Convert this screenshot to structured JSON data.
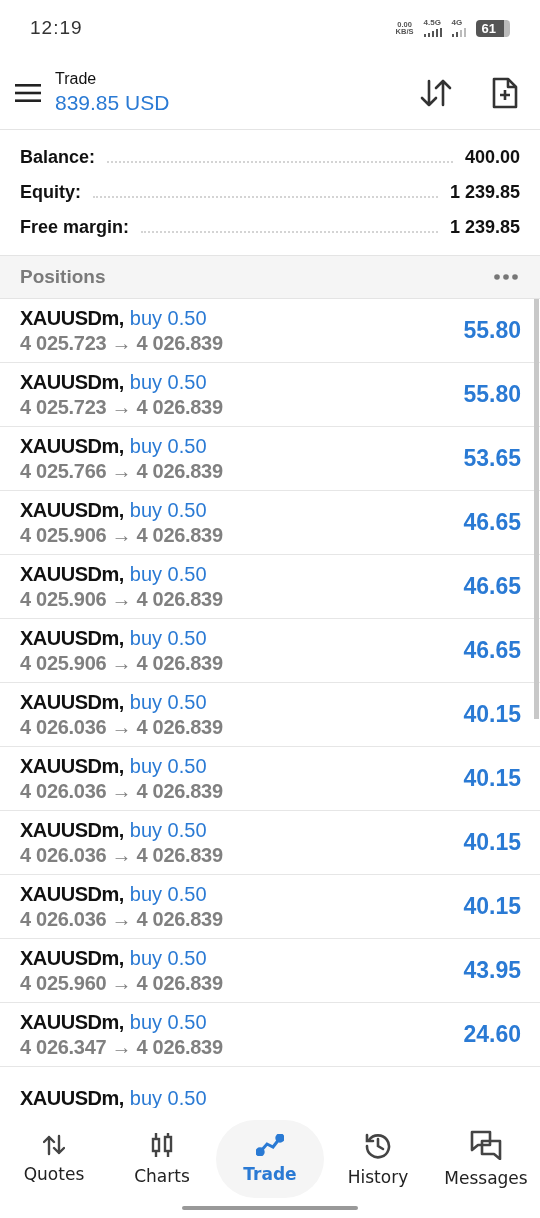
{
  "status_bar": {
    "time": "12:19",
    "speed_value": "0.00",
    "speed_unit": "KB/S",
    "network_1": "4.5G",
    "network_2": "4G",
    "battery": "61"
  },
  "header": {
    "title": "Trade",
    "balance": "839.85 USD"
  },
  "summary": [
    {
      "label": "Balance:",
      "value": "400.00"
    },
    {
      "label": "Equity:",
      "value": "1 239.85"
    },
    {
      "label": "Free margin:",
      "value": "1 239.85"
    }
  ],
  "positions": {
    "title": "Positions",
    "rows": [
      {
        "symbol": "XAUUSDm,",
        "side": "buy 0.50",
        "prices": "4 025.723 → 4 026.839",
        "profit": "55.80"
      },
      {
        "symbol": "XAUUSDm,",
        "side": "buy 0.50",
        "prices": "4 025.723 → 4 026.839",
        "profit": "55.80"
      },
      {
        "symbol": "XAUUSDm,",
        "side": "buy 0.50",
        "prices": "4 025.766 → 4 026.839",
        "profit": "53.65"
      },
      {
        "symbol": "XAUUSDm,",
        "side": "buy 0.50",
        "prices": "4 025.906 → 4 026.839",
        "profit": "46.65"
      },
      {
        "symbol": "XAUUSDm,",
        "side": "buy 0.50",
        "prices": "4 025.906 → 4 026.839",
        "profit": "46.65"
      },
      {
        "symbol": "XAUUSDm,",
        "side": "buy 0.50",
        "prices": "4 025.906 → 4 026.839",
        "profit": "46.65"
      },
      {
        "symbol": "XAUUSDm,",
        "side": "buy 0.50",
        "prices": "4 026.036 → 4 026.839",
        "profit": "40.15"
      },
      {
        "symbol": "XAUUSDm,",
        "side": "buy 0.50",
        "prices": "4 026.036 → 4 026.839",
        "profit": "40.15"
      },
      {
        "symbol": "XAUUSDm,",
        "side": "buy 0.50",
        "prices": "4 026.036 → 4 026.839",
        "profit": "40.15"
      },
      {
        "symbol": "XAUUSDm,",
        "side": "buy 0.50",
        "prices": "4 026.036 → 4 026.839",
        "profit": "40.15"
      },
      {
        "symbol": "XAUUSDm,",
        "side": "buy 0.50",
        "prices": "4 025.960 → 4 026.839",
        "profit": "43.95"
      },
      {
        "symbol": "XAUUSDm,",
        "side": "buy 0.50",
        "prices": "4 026.347 → 4 026.839",
        "profit": "24.60"
      },
      {
        "symbol": "XAUUSDm,",
        "side": "buy 0.50"
      }
    ]
  },
  "nav": [
    {
      "kind": "quotes",
      "label": "Quotes",
      "selected": false
    },
    {
      "kind": "charts",
      "label": "Charts",
      "selected": false
    },
    {
      "kind": "trade",
      "label": "Trade",
      "selected": true
    },
    {
      "kind": "history",
      "label": "History",
      "selected": false
    },
    {
      "kind": "messages",
      "label": "Messages",
      "selected": false
    }
  ]
}
